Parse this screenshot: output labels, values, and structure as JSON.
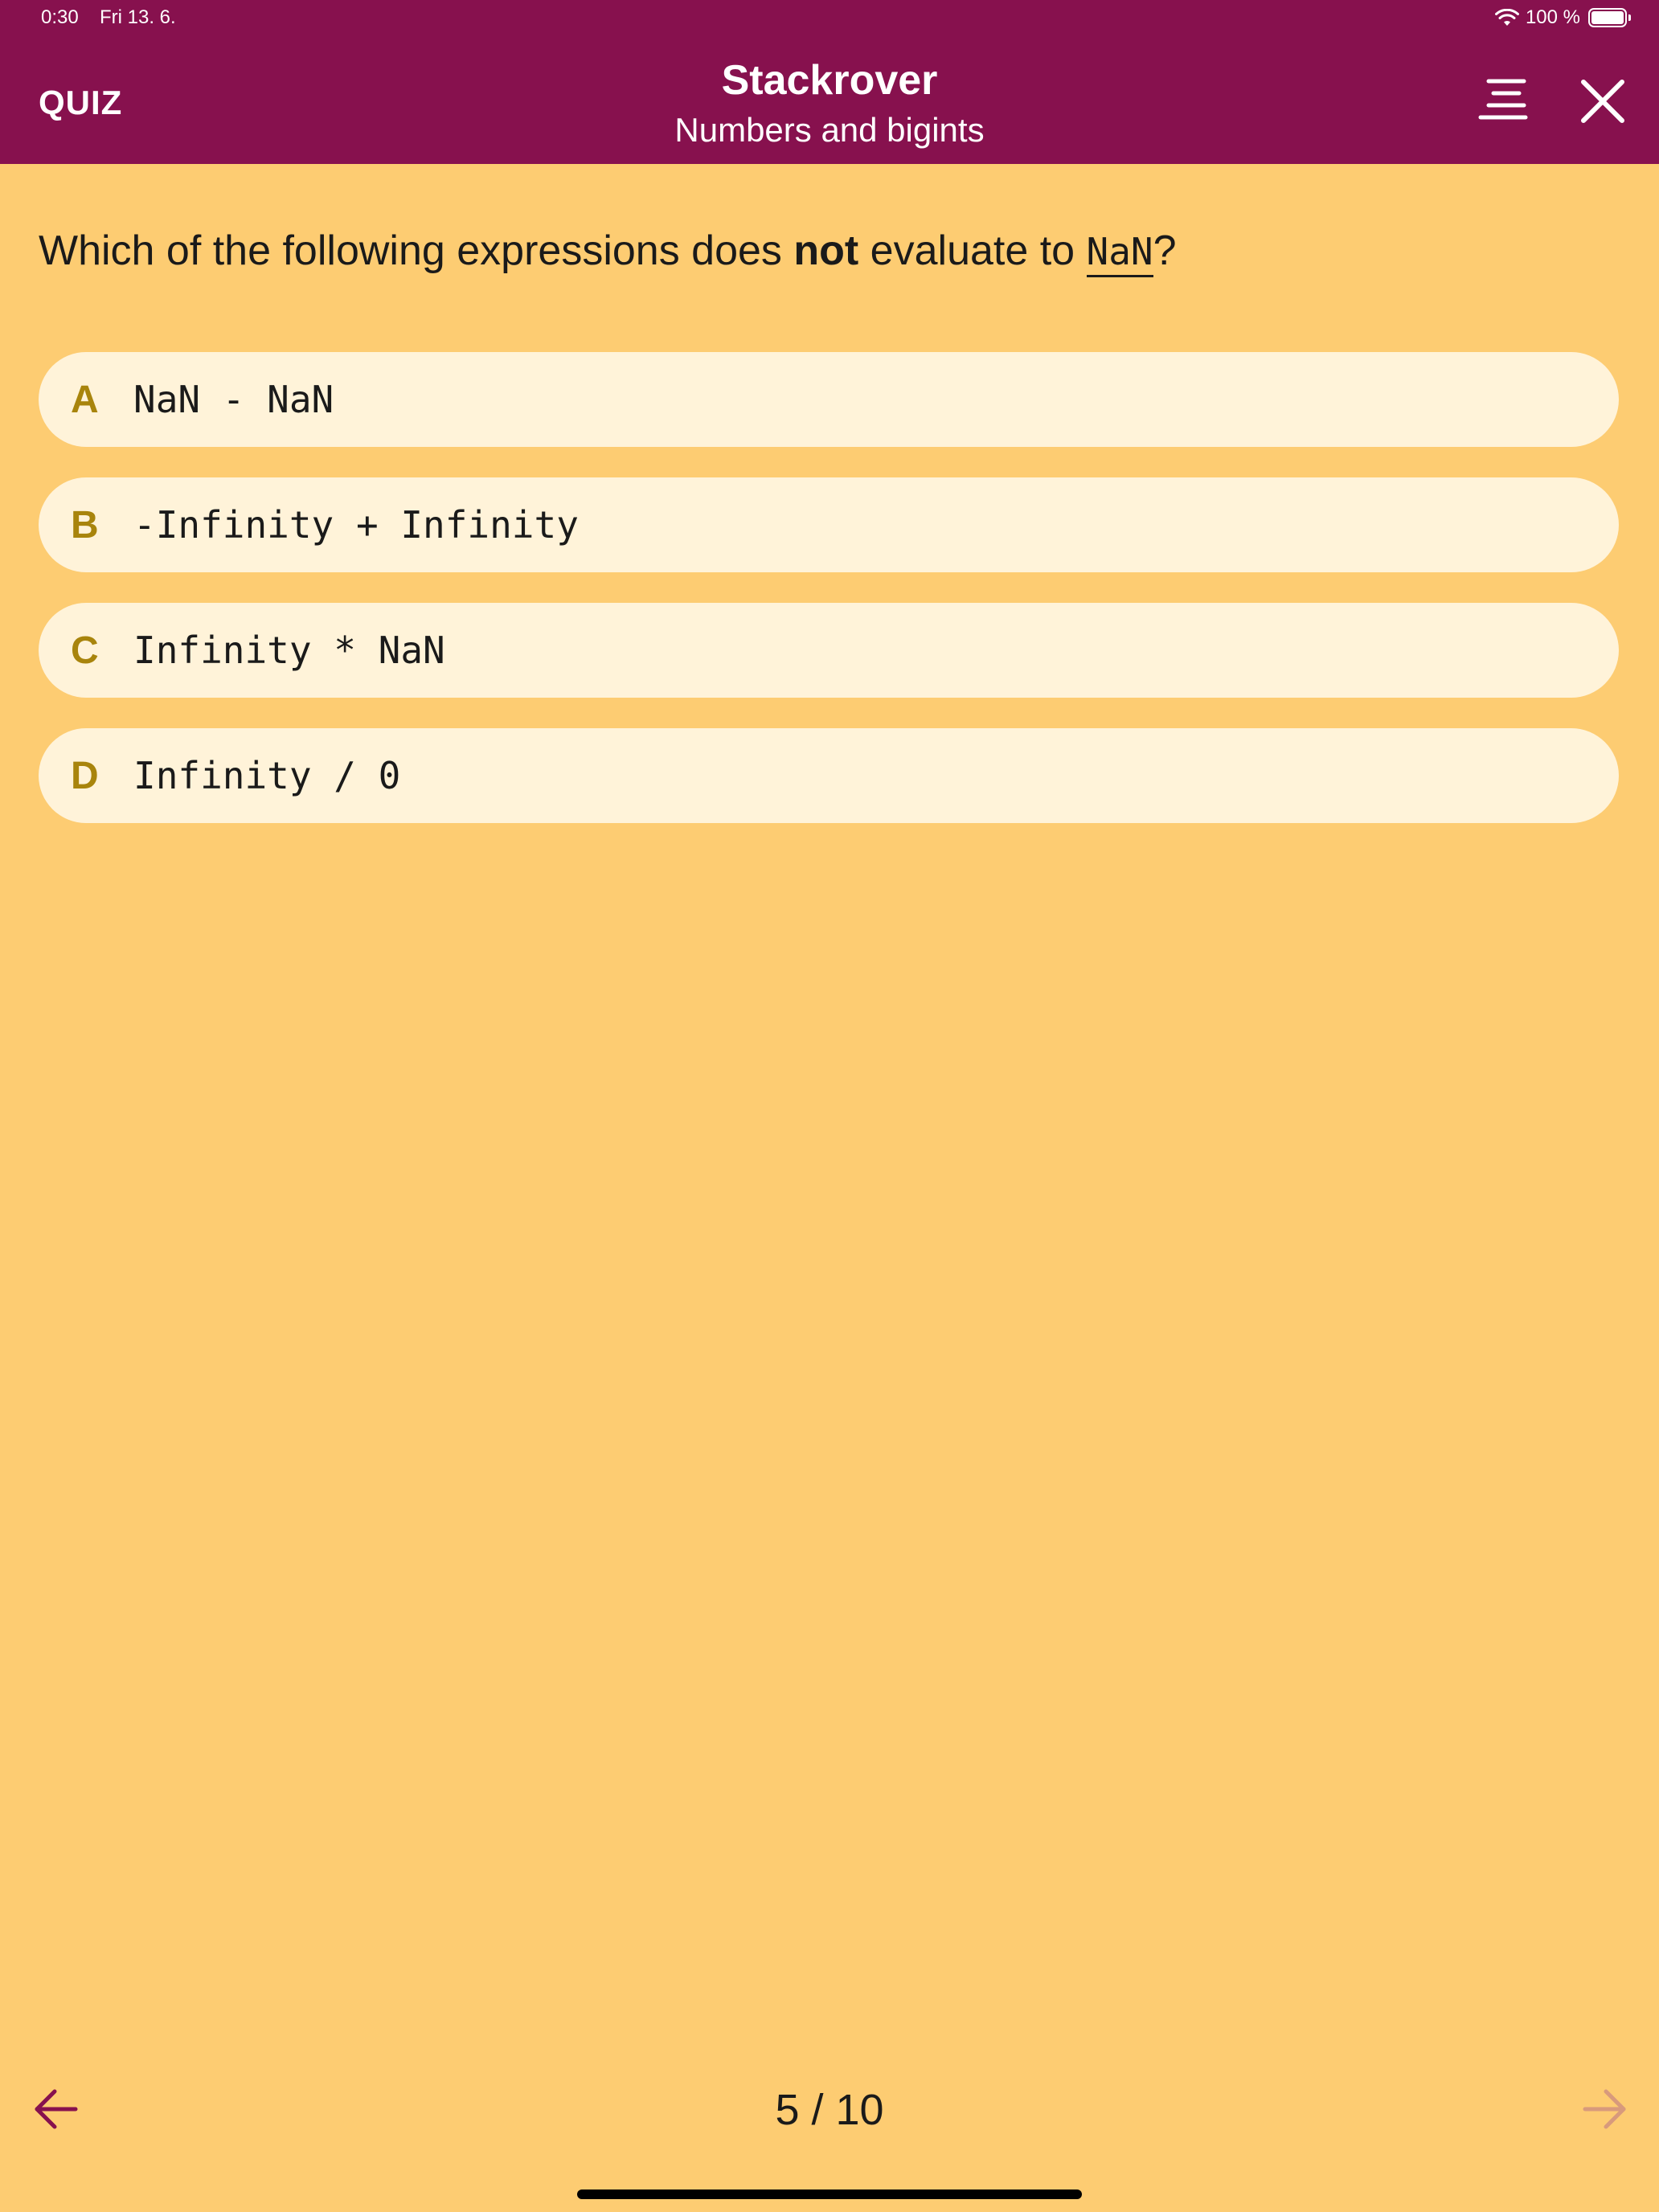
{
  "status_bar": {
    "time": "0:30",
    "date": "Fri 13. 6.",
    "battery": "100 %",
    "icons": [
      "wifi-icon",
      "battery-icon"
    ]
  },
  "header": {
    "section_label": "QUIZ",
    "title": "Stackrover",
    "subtitle": "Numbers and bigints",
    "icons": [
      "menu-icon",
      "close-icon"
    ]
  },
  "question": {
    "prefix": "Which of the following expressions does ",
    "emphasis": "not",
    "middle": " evaluate to ",
    "code": "NaN",
    "suffix": "?"
  },
  "options": [
    {
      "letter": "A",
      "code": "NaN - NaN"
    },
    {
      "letter": "B",
      "code": "-Infinity + Infinity"
    },
    {
      "letter": "C",
      "code": "Infinity * NaN"
    },
    {
      "letter": "D",
      "code": "Infinity / 0"
    }
  ],
  "footer": {
    "progress": "5 / 10",
    "icons": [
      "arrow-left-icon",
      "arrow-right-icon"
    ]
  },
  "colors": {
    "header_bg": "#87114E",
    "page_bg": "#FDCC72",
    "option_bg": "#FFF3D9",
    "option_letter": "#A8840C",
    "back_arrow": "#87114E",
    "next_arrow": "#D89A7C"
  }
}
